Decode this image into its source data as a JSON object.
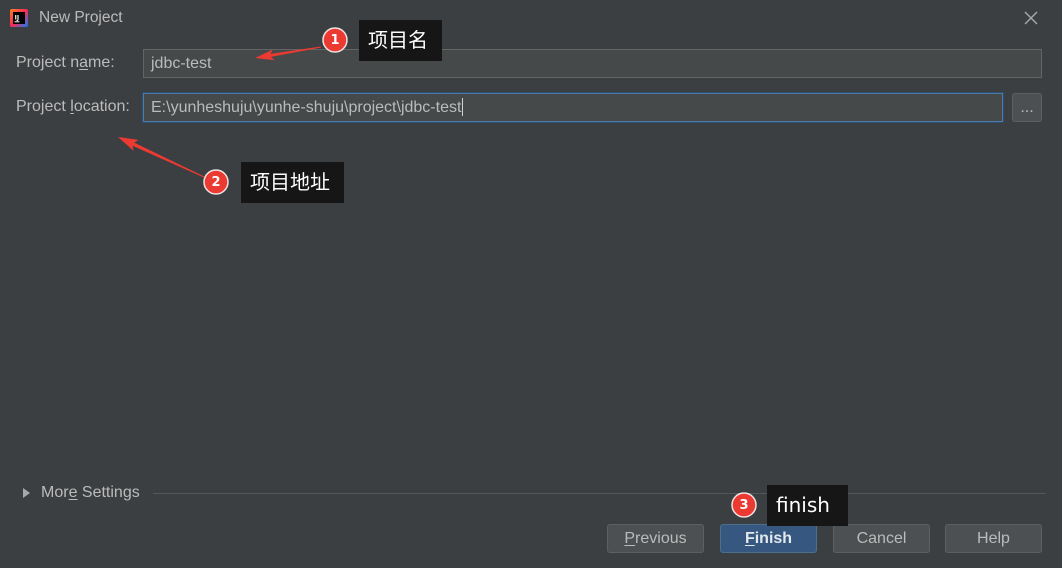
{
  "window": {
    "title": "New Project",
    "logo_text": "IJ",
    "app_icon": "intellij-idea-icon",
    "close_icon": "close-icon"
  },
  "form": {
    "project_name": {
      "label": "Project name:",
      "mnemonic": "a",
      "value": "jdbc-test"
    },
    "project_location": {
      "label": "Project location:",
      "mnemonic": "l",
      "value": "E:\\yunheshuju\\yunhe-shuju\\project\\jdbc-test",
      "focused": true,
      "browse_label": "..."
    }
  },
  "more_settings": {
    "label": "More Settings",
    "mnemonic": "e",
    "expanded": false,
    "icon": "triangle-right-icon"
  },
  "buttons": [
    {
      "label": "Previous",
      "mnemonic": "P",
      "default": false
    },
    {
      "label": "Finish",
      "mnemonic": "F",
      "default": true
    },
    {
      "label": "Cancel",
      "default": false
    },
    {
      "label": "Help",
      "default": false
    }
  ],
  "annotations": [
    {
      "number": "1",
      "text": "项目名"
    },
    {
      "number": "2",
      "text": "项目地址"
    },
    {
      "number": "3",
      "text": "finish"
    }
  ],
  "colors": {
    "window_background": "#3c3f41",
    "text": "#bbbbbb",
    "field_background": "#45494a",
    "focus_border": "#4b7bab",
    "default_button": "#365880",
    "annotation_red": "#ea3a32",
    "annotation_box": "#161616"
  }
}
